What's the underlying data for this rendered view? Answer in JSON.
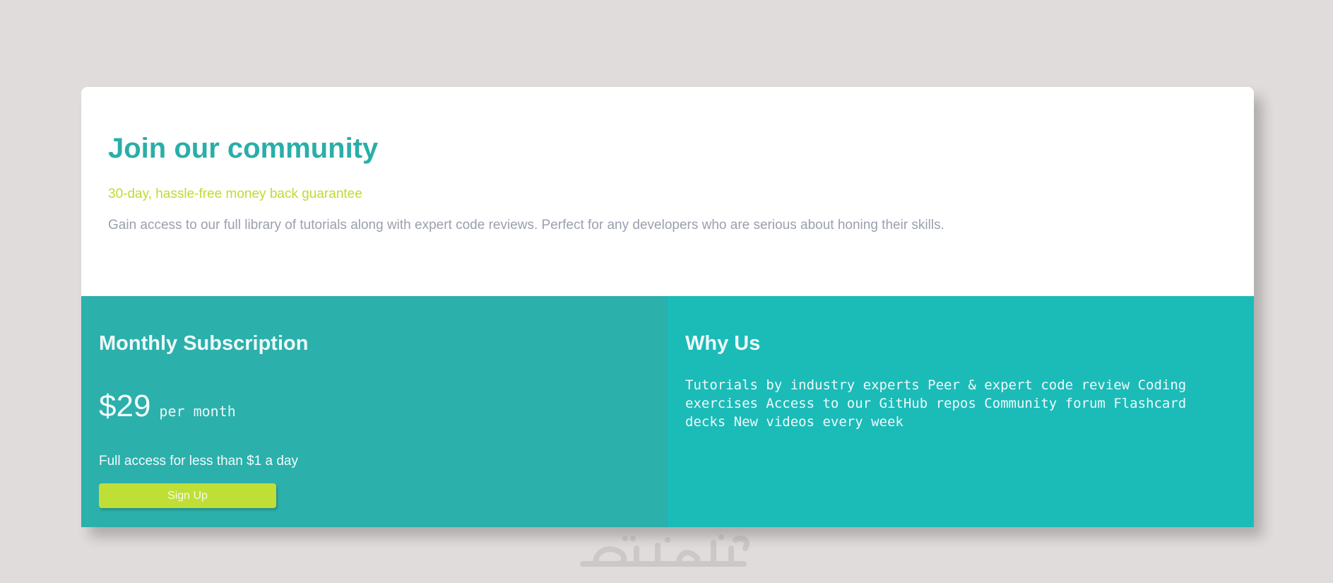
{
  "card": {
    "title": "Join our community",
    "guarantee": "30-day, hassle-free money back guarantee",
    "description": "Gain access to our full library of tutorials along with expert code reviews. Perfect for any developers who are serious about honing their skills."
  },
  "monthly": {
    "heading": "Monthly Subscription",
    "price": "$29",
    "period": "per month",
    "access_text": "Full access for less than $1 a day",
    "signup_label": "Sign Up"
  },
  "why_us": {
    "heading": "Why Us",
    "text": "Tutorials by industry experts Peer & expert code review Coding exercises Access to our GitHub repos Community forum Flashcard decks New videos every week"
  },
  "watermark": {
    "text": "خمسات"
  },
  "colors": {
    "page_background": "#e1dcdc",
    "title": "#2aaea8",
    "guarantee": "#bfdb32",
    "description": "#9ba0ae",
    "monthly_panel": "#2bb0ac",
    "why_panel": "#1bbbb8",
    "signup_button": "#bfdf36"
  }
}
